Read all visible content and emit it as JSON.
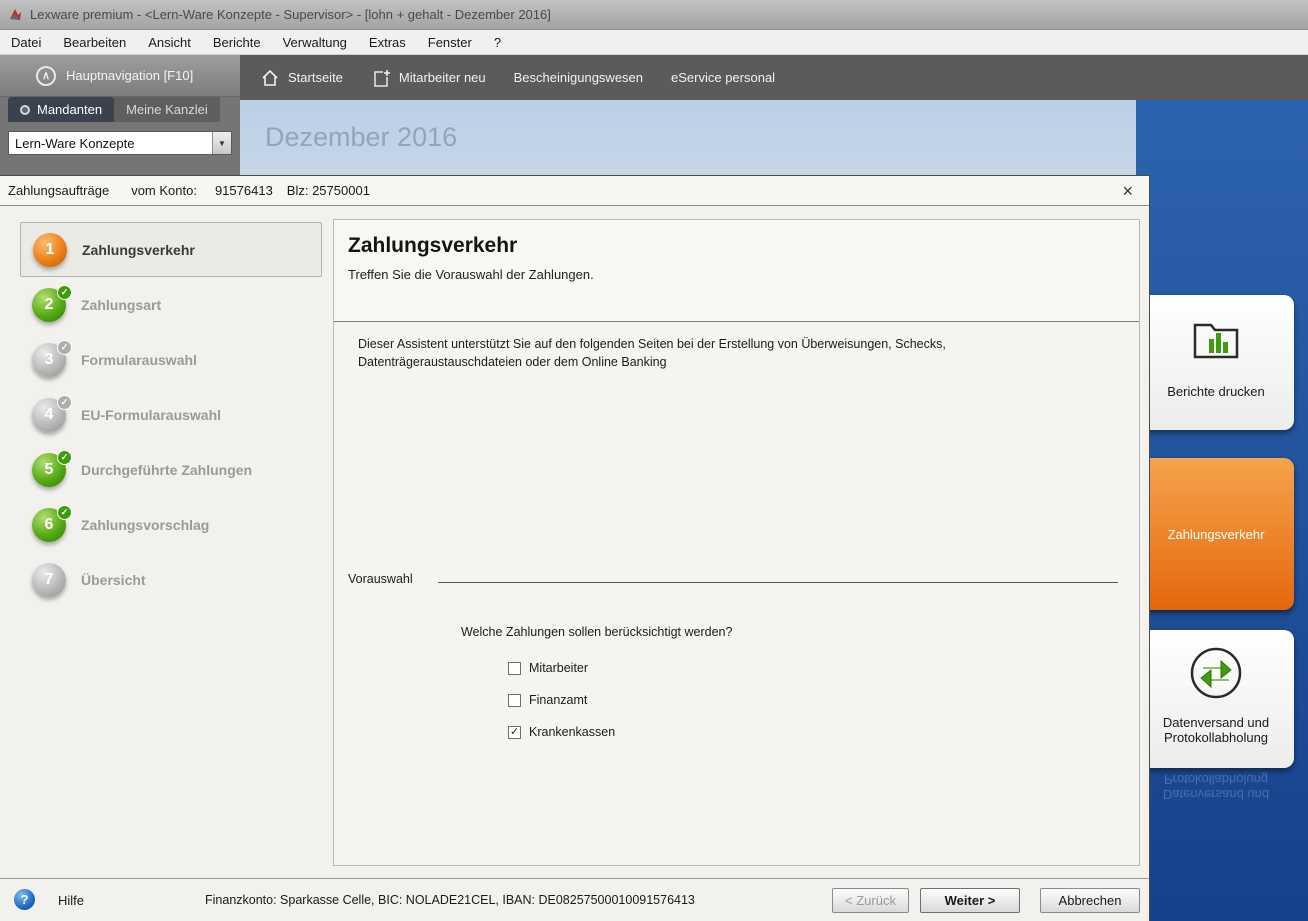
{
  "window": {
    "title": "Lexware premium - <Lern-Ware Konzepte - Supervisor> - [lohn + gehalt - Dezember 2016]"
  },
  "menubar": {
    "items": [
      "Datei",
      "Bearbeiten",
      "Ansicht",
      "Berichte",
      "Verwaltung",
      "Extras",
      "Fenster",
      "?"
    ]
  },
  "sidebar": {
    "hauptnavigation": "Hauptnavigation [F10]",
    "tabs": [
      {
        "label": "Mandanten"
      },
      {
        "label": "Meine Kanzlei"
      }
    ],
    "dropdown_value": "Lern-Ware Konzepte"
  },
  "toolbar": {
    "items": [
      "Startseite",
      "Mitarbeiter neu",
      "Bescheinigungswesen",
      "eService personal"
    ]
  },
  "background": {
    "period_title": "Dezember 2016"
  },
  "right_panel": {
    "buttons": [
      {
        "label": "Berichte drucken"
      },
      {
        "label": "Zahlungsverkehr"
      },
      {
        "label": "Datenversand und Protokollabholung"
      }
    ]
  },
  "dialog": {
    "title": "Zahlungsaufträge",
    "account_label": "vom Konto:",
    "account_number": "91576413",
    "blz": "Blz: 25750001",
    "steps": [
      {
        "num": "1",
        "label": "Zahlungsverkehr",
        "state": "active"
      },
      {
        "num": "2",
        "label": "Zahlungsart",
        "state": "done"
      },
      {
        "num": "3",
        "label": "Formularauswahl",
        "state": "inactive"
      },
      {
        "num": "4",
        "label": "EU-Formularauswahl",
        "state": "inactive"
      },
      {
        "num": "5",
        "label": "Durchgeführte Zahlungen",
        "state": "done"
      },
      {
        "num": "6",
        "label": "Zahlungsvorschlag",
        "state": "done"
      },
      {
        "num": "7",
        "label": "Übersicht",
        "state": "inactive"
      }
    ],
    "content": {
      "heading": "Zahlungsverkehr",
      "subheading": "Treffen Sie die Vorauswahl der Zahlungen.",
      "description": "Dieser Assistent unterstützt Sie auf den folgenden Seiten bei der Erstellung von Überweisungen, Schecks, Datenträgeraustauschdateien oder dem Online Banking",
      "section_label": "Vorauswahl",
      "question": "Welche Zahlungen sollen berücksichtigt werden?",
      "checkboxes": [
        {
          "label": "Mitarbeiter",
          "checked": false
        },
        {
          "label": "Finanzamt",
          "checked": false
        },
        {
          "label": "Krankenkassen",
          "checked": true
        }
      ]
    },
    "footer": {
      "help_label": "Hilfe",
      "finanzkonto": "Finanzkonto: Sparkasse Celle, BIC: NOLADE21CEL, IBAN: DE08257500010091576413",
      "back_label": "< Zurück",
      "next_label": "Weiter >",
      "cancel_label": "Abbrechen"
    }
  },
  "colors": {
    "accent_orange": "#e87c1e",
    "accent_green": "#3f9c0e",
    "accent_blue": "#1c52a2"
  },
  "icons": {
    "close": "×",
    "dropdown_arrow": "▼",
    "check": "✓",
    "help": "?",
    "chevron_up": "∧"
  }
}
